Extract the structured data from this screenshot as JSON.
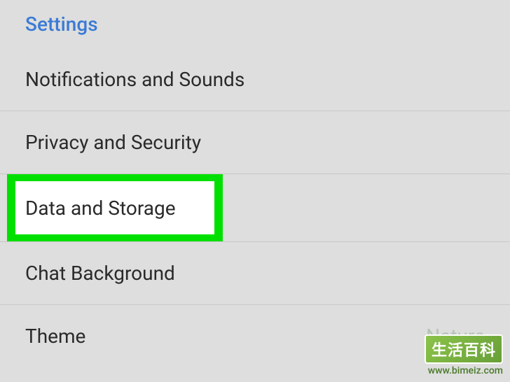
{
  "section": {
    "title": "Settings"
  },
  "menu": {
    "items": [
      {
        "label": "Notifications and Sounds"
      },
      {
        "label": "Privacy and Security"
      },
      {
        "label": "Data and Storage"
      },
      {
        "label": "Chat Background"
      },
      {
        "label": "Theme",
        "value": "Nature"
      }
    ]
  },
  "watermark": {
    "badge": "生活百科",
    "url": "www.bimeiz.com"
  }
}
